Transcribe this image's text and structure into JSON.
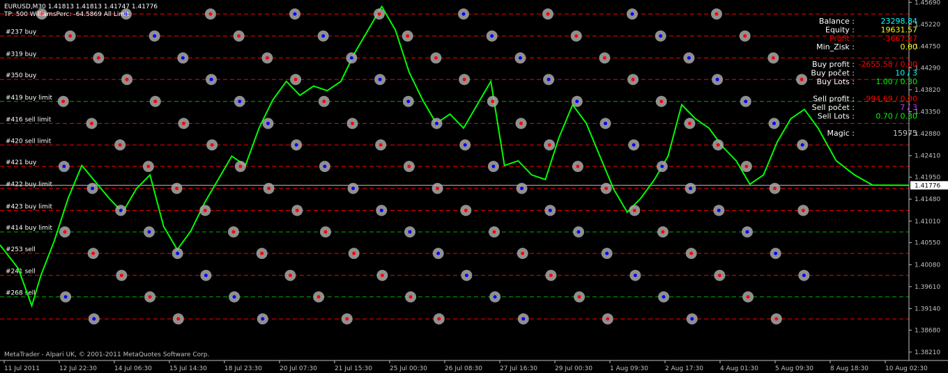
{
  "header": {
    "symbol_line": "EURUSD,M30  1.41813 1.41813 1.41747 1.41776",
    "indicator_line": "TP: 500 WilliamsPerc: -64.5869 All Limit"
  },
  "footer": {
    "copyright": "MetaTrader - Alpari UK, © 2001-2011 MetaQuotes Software Corp."
  },
  "colors": {
    "background": "#000000",
    "price": "#00ff00",
    "sell_level": "#ff0000",
    "buy_level": "#0000ff",
    "pending_level": "#00aa00",
    "current_price": "#c0c0c0",
    "axis": "#c0c0c0",
    "marker_fill": "#a8a8a8",
    "label_white": "#ffffff",
    "value_cyan": "#00ffff",
    "value_yellow": "#ffff00",
    "value_red": "#ff0000",
    "value_green": "#00ff00",
    "value_magenta": "#cc33ff",
    "value_gray": "#c0c0c0"
  },
  "panel": {
    "rows": [
      {
        "label": "Balance :",
        "value": "23298.84",
        "label_color": "#ffffff",
        "value_color": "#00ffff"
      },
      {
        "label": "Equity :",
        "value": "19631.57",
        "label_color": "#ffffff",
        "value_color": "#ffff00"
      },
      {
        "label": "Profit :",
        "value": "-3667.27",
        "label_color": "#ff0000",
        "value_color": "#ff0000"
      },
      {
        "label": "Min_Zisk :",
        "value": "0.00",
        "label_color": "#ffffff",
        "value_color": "#ffff00"
      },
      {
        "label": "",
        "value": "",
        "label_color": "#ffffff",
        "value_color": "#ffffff"
      },
      {
        "label": "Buy profit :",
        "value": "-2655.58 / 0.00",
        "label_color": "#ffffff",
        "value_color": "#ff0000"
      },
      {
        "label": "Buy počet :",
        "value": "10 / 3",
        "label_color": "#ffffff",
        "value_color": "#00ffff"
      },
      {
        "label": "Buy Lots :",
        "value": "1.00 / 0.30",
        "label_color": "#ffffff",
        "value_color": "#00ff00"
      },
      {
        "label": "",
        "value": "",
        "label_color": "#ffffff",
        "value_color": "#ffffff"
      },
      {
        "label": "Sell profit :",
        "value": "-994.69 / 0.00",
        "label_color": "#ffffff",
        "value_color": "#ff0000"
      },
      {
        "label": "Sell počet :",
        "value": "7 / 3",
        "label_color": "#ffffff",
        "value_color": "#cc33ff"
      },
      {
        "label": "Sell Lots :",
        "value": "0.70 / 0.30",
        "label_color": "#ffffff",
        "value_color": "#00ff00"
      },
      {
        "label": "",
        "value": "",
        "label_color": "#ffffff",
        "value_color": "#ffffff"
      },
      {
        "label": "Magic :",
        "value": "15975",
        "label_color": "#ffffff",
        "value_color": "#c0c0c0"
      }
    ]
  },
  "chart_data": {
    "type": "line",
    "symbol": "EURUSD",
    "timeframe": "M30",
    "ylim": [
      1.3803,
      1.4568
    ],
    "current_price": 1.41776,
    "current_price_label": "1.41776",
    "y_ticks": [
      {
        "value": 1.4569,
        "label": "1.45690"
      },
      {
        "value": 1.4522,
        "label": "1.45220"
      },
      {
        "value": 1.4475,
        "label": "1.44750"
      },
      {
        "value": 1.4429,
        "label": "1.44290"
      },
      {
        "value": 1.4382,
        "label": "1.43820"
      },
      {
        "value": 1.4335,
        "label": "1.43350"
      },
      {
        "value": 1.4288,
        "label": "1.42880"
      },
      {
        "value": 1.4241,
        "label": "1.42410"
      },
      {
        "value": 1.4195,
        "label": "1.41950"
      },
      {
        "value": 1.4148,
        "label": "1.41480"
      },
      {
        "value": 1.4101,
        "label": "1.41010"
      },
      {
        "value": 1.4055,
        "label": "1.40550"
      },
      {
        "value": 1.4008,
        "label": "1.40080"
      },
      {
        "value": 1.3961,
        "label": "1.39610"
      },
      {
        "value": 1.3914,
        "label": "1.39140"
      },
      {
        "value": 1.3868,
        "label": "1.38680"
      },
      {
        "value": 1.3821,
        "label": "1.38210"
      }
    ],
    "x_ticks": [
      "11 Jul 2011",
      "12 Jul 22:30",
      "14 Jul 06:30",
      "15 Jul 14:30",
      "18 Jul 23:30",
      "20 Jul 07:30",
      "21 Jul 15:30",
      "25 Jul 00:30",
      "26 Jul 08:30",
      "27 Jul 16:30",
      "29 Jul 00:30",
      "1 Aug 09:30",
      "2 Aug 17:30",
      "4 Aug 01:30",
      "5 Aug 09:30",
      "8 Aug 18:30",
      "10 Aug 02:30"
    ],
    "levels": [
      {
        "price": 1.4544,
        "kind": "sell",
        "label": ""
      },
      {
        "price": 1.4497,
        "kind": "sell",
        "label": "#237 buy"
      },
      {
        "price": 1.445,
        "kind": "sell",
        "label": "#319 buy"
      },
      {
        "price": 1.4404,
        "kind": "sell",
        "label": "#350 buy"
      },
      {
        "price": 1.4357,
        "kind": "pending",
        "label": "#419 buy limit"
      },
      {
        "price": 1.431,
        "kind": "sell",
        "label": "#416 sell limit"
      },
      {
        "price": 1.4264,
        "kind": "sell",
        "label": "#420 sell limit"
      },
      {
        "price": 1.4218,
        "kind": "sell",
        "label": "#421 buy"
      },
      {
        "price": 1.4171,
        "kind": "sell",
        "label": "#422 buy limit"
      },
      {
        "price": 1.4124,
        "kind": "sell",
        "label": "#423 buy limit"
      },
      {
        "price": 1.4078,
        "kind": "pending",
        "label": "#414 buy limit"
      },
      {
        "price": 1.4032,
        "kind": "sell",
        "label": "#253 sell"
      },
      {
        "price": 1.3985,
        "kind": "sell",
        "label": "#241 sell"
      },
      {
        "price": 1.3939,
        "kind": "pending",
        "label": "#268 sell"
      },
      {
        "price": 1.3892,
        "kind": "sell",
        "label": ""
      }
    ],
    "price_path": [
      [
        0,
        1.405
      ],
      [
        0.02,
        1.4
      ],
      [
        0.035,
        1.392
      ],
      [
        0.045,
        1.3985
      ],
      [
        0.06,
        1.406
      ],
      [
        0.075,
        1.415
      ],
      [
        0.09,
        1.422
      ],
      [
        0.105,
        1.4185
      ],
      [
        0.12,
        1.415
      ],
      [
        0.135,
        1.412
      ],
      [
        0.15,
        1.417
      ],
      [
        0.165,
        1.42
      ],
      [
        0.18,
        1.409
      ],
      [
        0.195,
        1.404
      ],
      [
        0.21,
        1.408
      ],
      [
        0.225,
        1.414
      ],
      [
        0.24,
        1.419
      ],
      [
        0.255,
        1.424
      ],
      [
        0.27,
        1.422
      ],
      [
        0.285,
        1.43
      ],
      [
        0.3,
        1.436
      ],
      [
        0.315,
        1.44
      ],
      [
        0.33,
        1.437
      ],
      [
        0.345,
        1.439
      ],
      [
        0.36,
        1.438
      ],
      [
        0.375,
        1.44
      ],
      [
        0.39,
        1.446
      ],
      [
        0.405,
        1.451
      ],
      [
        0.42,
        1.456
      ],
      [
        0.435,
        1.451
      ],
      [
        0.45,
        1.442
      ],
      [
        0.465,
        1.436
      ],
      [
        0.48,
        1.431
      ],
      [
        0.495,
        1.433
      ],
      [
        0.51,
        1.43
      ],
      [
        0.525,
        1.435
      ],
      [
        0.54,
        1.44
      ],
      [
        0.555,
        1.422
      ],
      [
        0.57,
        1.423
      ],
      [
        0.585,
        1.42
      ],
      [
        0.6,
        1.419
      ],
      [
        0.615,
        1.428
      ],
      [
        0.63,
        1.435
      ],
      [
        0.645,
        1.431
      ],
      [
        0.66,
        1.424
      ],
      [
        0.675,
        1.417
      ],
      [
        0.69,
        1.412
      ],
      [
        0.705,
        1.415
      ],
      [
        0.72,
        1.419
      ],
      [
        0.735,
        1.424
      ],
      [
        0.75,
        1.435
      ],
      [
        0.765,
        1.432
      ],
      [
        0.78,
        1.43
      ],
      [
        0.795,
        1.426
      ],
      [
        0.81,
        1.423
      ],
      [
        0.825,
        1.418
      ],
      [
        0.84,
        1.42
      ],
      [
        0.855,
        1.427
      ],
      [
        0.87,
        1.432
      ],
      [
        0.885,
        1.434
      ],
      [
        0.9,
        1.43
      ],
      [
        0.92,
        1.423
      ],
      [
        0.94,
        1.42
      ],
      [
        0.96,
        1.4178
      ],
      [
        1.0,
        1.41776
      ]
    ]
  }
}
